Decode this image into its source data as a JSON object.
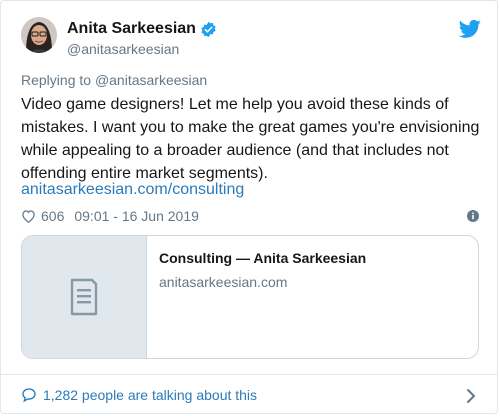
{
  "author": {
    "name": "Anita Sarkeesian",
    "handle": "@anitasarkeesian"
  },
  "reply": {
    "prefix": "Replying to ",
    "mention": "@anitasarkeesian"
  },
  "tweet": {
    "text": "Video game designers! Let me help you avoid these kinds of mistakes. I want you to make the great games you're envisioning while appealing to a broader audience (and that includes not offending entire market segments).",
    "link": "anitasarkeesian.com/consulting"
  },
  "meta": {
    "likes": "606",
    "timestamp": "09:01 - 16 Jun 2019"
  },
  "preview": {
    "title": "Consulting — Anita Sarkeesian",
    "domain": "anitasarkeesian.com"
  },
  "footer": {
    "talking": "1,282 people are talking about this"
  },
  "icons": {
    "verified": "verified-badge-icon",
    "twitter": "twitter-bird-icon",
    "heart": "heart-icon",
    "info": "info-icon",
    "document": "document-icon",
    "comment": "comment-bubble-icon",
    "chevron": "chevron-right-icon"
  },
  "colors": {
    "link": "#2b7bb9",
    "muted": "#657786",
    "verified": "#1da1f2",
    "border": "#e1e8ed"
  }
}
